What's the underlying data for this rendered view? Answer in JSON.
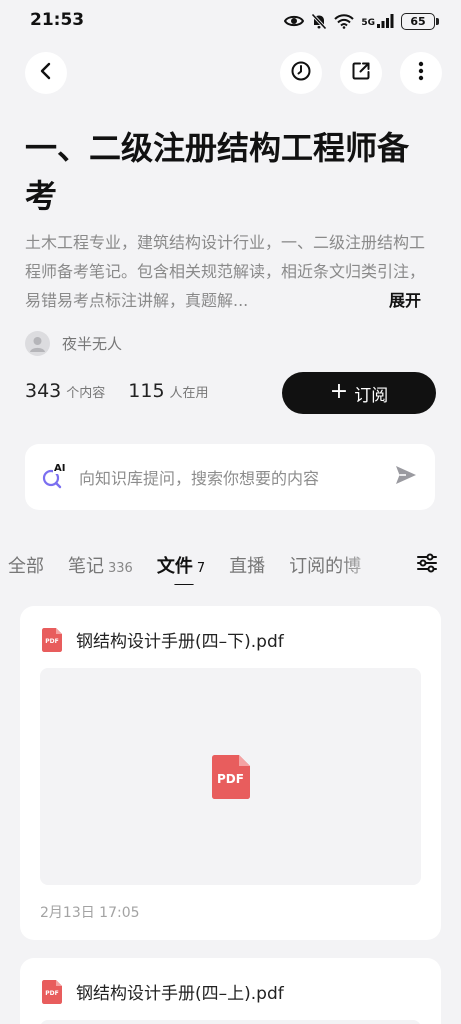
{
  "status_bar": {
    "time": "21:53",
    "network": "5G",
    "battery": "65",
    "icons": [
      "eye-icon",
      "bell-off-icon",
      "wifi-icon",
      "signal-icon",
      "battery-icon"
    ]
  },
  "nav": {
    "icons": [
      "back-icon",
      "history-icon",
      "share-icon",
      "more-icon"
    ]
  },
  "header": {
    "title": "一、二级注册结构工程师备考",
    "description": "土木工程专业，建筑结构设计行业，一、二级注册结构工程师备考笔记。包含相关规范解读，相近条文归类引注，易错易考点标注讲解，真题解...",
    "expand_label": "展开",
    "author": "夜半无人"
  },
  "stats": {
    "content_count": "343",
    "content_label": "个内容",
    "user_count": "115",
    "user_label": "人在用"
  },
  "subscribe": {
    "icon": "+",
    "label": "订阅"
  },
  "ai_search": {
    "icon_text": "AI",
    "placeholder": "向知识库提问，搜索你想要的内容"
  },
  "tabs": [
    {
      "label": "全部",
      "count": ""
    },
    {
      "label": "笔记",
      "count": "336"
    },
    {
      "label": "文件",
      "count": "7",
      "active": true
    },
    {
      "label": "直播",
      "count": ""
    },
    {
      "label": "订阅的博",
      "count": ""
    }
  ],
  "files": [
    {
      "name": "钢结构设计手册(四–下).pdf",
      "date": "2月13日 17:05",
      "preview_label": "PDF",
      "icon_label": "PDF"
    },
    {
      "name": "钢结构设计手册(四–上).pdf",
      "icon_label": "PDF"
    }
  ],
  "colors": {
    "background": "#f3f3f5",
    "card": "#ffffff",
    "primary_button": "#111111",
    "pdf_red": "#e85d5d",
    "ai_purple": "#7b6ff0"
  }
}
